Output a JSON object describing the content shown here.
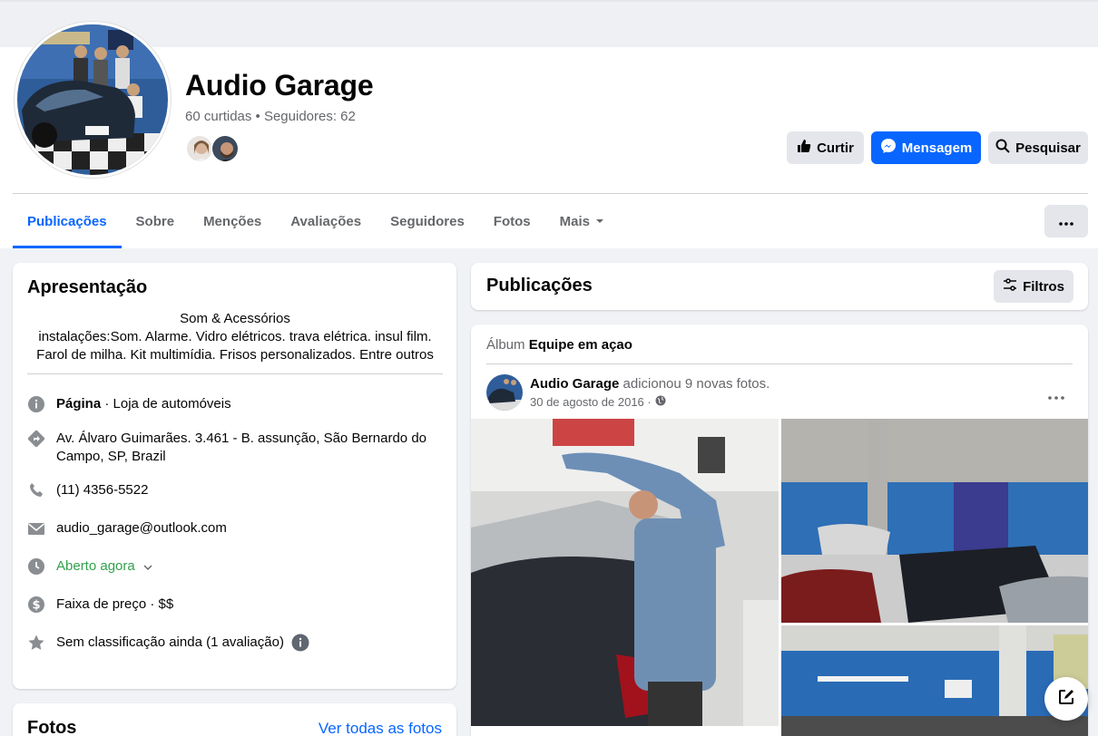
{
  "page": {
    "name": "Audio Garage",
    "stats": "60 curtidas • Seguidores: 62"
  },
  "actions": {
    "like": "Curtir",
    "message": "Mensagem",
    "search": "Pesquisar"
  },
  "tabs": [
    {
      "label": "Publicações",
      "active": true
    },
    {
      "label": "Sobre"
    },
    {
      "label": "Menções"
    },
    {
      "label": "Avaliações"
    },
    {
      "label": "Seguidores"
    },
    {
      "label": "Fotos"
    },
    {
      "label": "Mais"
    }
  ],
  "intro": {
    "title": "Apresentação",
    "bio_line1": "Som & Acessórios",
    "bio_line2": "instalações:Som. Alarme. Vidro elétricos. trava elétrica. insul film.",
    "bio_line3": "Farol de milha. Kit multimídia. Frisos personalizados. Entre outros",
    "page_type_label": "Página",
    "page_type_value": " · Loja de automóveis",
    "address": "Av. Álvaro Guimarães. 3.461 - B. assunção, São Bernardo do Campo, SP, Brazil",
    "phone": "(11) 4356-5522",
    "email": "audio_garage@outlook.com",
    "hours": "Aberto agora",
    "price": "Faixa de preço · $$",
    "rating": "Sem classificação ainda (1 avaliação)"
  },
  "photos_card": {
    "title": "Fotos",
    "see_all": "Ver todas as fotos"
  },
  "posts": {
    "title": "Publicações",
    "filters": "Filtros"
  },
  "post": {
    "album_label": "Álbum",
    "album_name": "Equipe em açao",
    "author": "Audio Garage",
    "action": " adicionou 9 novas fotos.",
    "date": "30 de agosto de 2016 ·"
  },
  "colors": {
    "accent": "#0866ff",
    "open_green": "#31a24c"
  }
}
